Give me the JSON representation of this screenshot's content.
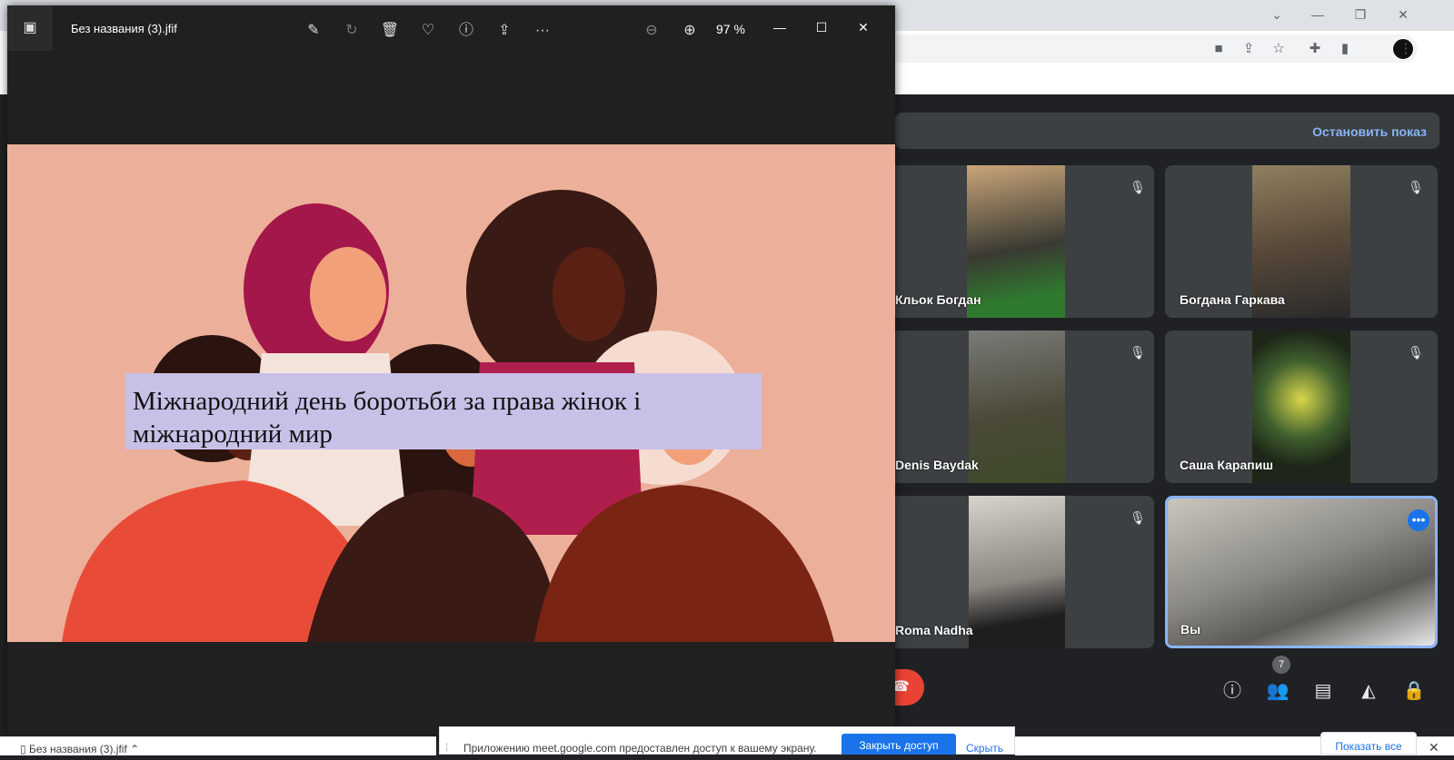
{
  "photos": {
    "title": "Без названия (3).jfif",
    "zoom": "97 %",
    "icons": [
      "photo-app-icon",
      "edit-icon",
      "rotate-icon",
      "delete-icon",
      "favorite-icon",
      "info-icon",
      "share-icon",
      "more-icon",
      "zoom-out-icon",
      "zoom-in-icon"
    ]
  },
  "slide": {
    "caption": "Міжнародний день боротьби за права жінок і міжнародний мир"
  },
  "meet": {
    "stop_presenting": "Остановить показ",
    "participants": [
      {
        "name": "Кльок Богдан",
        "muted": true
      },
      {
        "name": "Богдана Гаркава",
        "muted": true
      },
      {
        "name": "Denis Baydak",
        "muted": true
      },
      {
        "name": "Саша Карапиш",
        "muted": true
      },
      {
        "name": "Roma Nadha",
        "muted": true
      },
      {
        "name": "Вы",
        "muted": false
      }
    ],
    "people_count": "7"
  },
  "banner": {
    "text": "Приложению meet.google.com предоставлен доступ к вашему экрану.",
    "stop_sharing": "Закрыть доступ",
    "hide": "Скрыть"
  },
  "downloads": {
    "item": "Без названия (3).jfif",
    "show_all": "Показать все"
  },
  "colors": {
    "accent": "#1a73e8",
    "meet_link": "#8ab4f8",
    "leave": "#ea4335",
    "poster_bg": "#ecb09a",
    "caption_bg": "#c9c0e8"
  }
}
